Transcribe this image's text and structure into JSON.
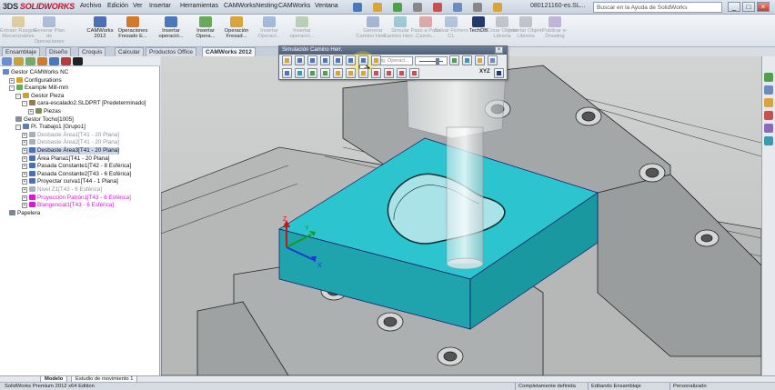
{
  "app": {
    "brand_ds": "3DS",
    "brand_name": "SOLIDWORKS",
    "menu": [
      "Archivo",
      "Edición",
      "Ver",
      "Insertar",
      "Herramientas",
      "CAMWorksNesting",
      "CAMWorks",
      "Ventana"
    ],
    "doc_title": "080121160-es.SL...",
    "search_placeholder": "Buscar en la Ayuda de SolidWorks",
    "window_buttons": [
      "_",
      "□",
      "×"
    ]
  },
  "command_bar": {
    "items": [
      {
        "label": "Extraer Rasgos Mecanizables",
        "enabled": false
      },
      {
        "label": "Generar Plan de Operaciones",
        "enabled": false
      },
      {
        "label": "CAMWorks 2012",
        "enabled": true
      },
      {
        "label": "Operaciones Fresado E...",
        "enabled": true
      },
      {
        "label": "Insertar operació...",
        "enabled": true
      },
      {
        "label": "Insertar Opera...",
        "enabled": true
      },
      {
        "label": "Operación Fresad...",
        "enabled": true
      },
      {
        "label": "Insertar Operaci...",
        "enabled": false
      },
      {
        "label": "Insertar operació...",
        "enabled": false
      },
      {
        "label": "Generar Camino Herr...",
        "enabled": false
      },
      {
        "label": "Simular Camino Herr...",
        "enabled": false
      },
      {
        "label": "Paso a Paso Camin...",
        "enabled": false
      },
      {
        "label": "Salvar Fichero CL",
        "enabled": false
      },
      {
        "label": "TechDB",
        "enabled": true
      },
      {
        "label": "Crear Objeto Libreria",
        "enabled": false
      },
      {
        "label": "Insertar Objeto Libreria",
        "enabled": false
      },
      {
        "label": "Publicar e-Drawing",
        "enabled": false
      }
    ]
  },
  "tabs": [
    {
      "label": "Ensamblaje",
      "active": false
    },
    {
      "label": "Diseño",
      "active": false
    },
    {
      "label": "Croquis",
      "active": false
    },
    {
      "label": "Calcular",
      "active": false
    },
    {
      "label": "Productos Office",
      "active": false
    },
    {
      "label": "CAMWorks 2012",
      "active": true
    }
  ],
  "tree": {
    "rows": [
      {
        "label": "Gestor CAMWorks NC",
        "indent": 0,
        "style": "",
        "icon": "#5b8bc9"
      },
      {
        "label": "Configurations",
        "indent": 1,
        "style": "",
        "icon": "#d4a429",
        "exp": "+"
      },
      {
        "label": "Example Mill-mm",
        "indent": 1,
        "style": "",
        "icon": "#6aa85a",
        "exp": "-"
      },
      {
        "label": "Gestor Pieza",
        "indent": 2,
        "style": "",
        "icon": "#c9a13c",
        "exp": "-"
      },
      {
        "label": "cara-escalado2.SLDPRT [Predeterminado]",
        "indent": 3,
        "style": "",
        "icon": "#9a7b4f",
        "exp": "-"
      },
      {
        "label": "Piezas",
        "indent": 4,
        "style": "",
        "icon": "#7e8f55",
        "exp": "+"
      },
      {
        "label": "Gestor Tocho[1005]",
        "indent": 2,
        "style": "",
        "icon": "#8a8f96"
      },
      {
        "label": "Pl. Trabajo1 [Grupo1]",
        "indent": 2,
        "style": "",
        "icon": "#5f7fb3",
        "exp": "-"
      },
      {
        "label": "Desbaste Área1[T41 - 20 Plana]",
        "indent": 3,
        "style": "grey",
        "icon": "#a9b0b8",
        "exp": "+"
      },
      {
        "label": "Desbaste Área2[T41 - 20 Plana]",
        "indent": 3,
        "style": "grey",
        "icon": "#a9b0b8",
        "exp": "+"
      },
      {
        "label": "Desbaste Área3[T41 - 20 Plana]",
        "indent": 3,
        "style": "hl",
        "icon": "#4e6fb0",
        "exp": "+"
      },
      {
        "label": "Área Plana1[T41 - 20 Plana]",
        "indent": 3,
        "style": "",
        "icon": "#4e6fb0",
        "exp": "+"
      },
      {
        "label": "Pasada Constante1[T42 - 8 Esférica]",
        "indent": 3,
        "style": "",
        "icon": "#4e6fb0",
        "exp": "+"
      },
      {
        "label": "Pasada Constante2[T43 - 6 Esférica]",
        "indent": 3,
        "style": "",
        "icon": "#4e6fb0",
        "exp": "+"
      },
      {
        "label": "Proyectar curva1[T44 - 1 Plana]",
        "indent": 3,
        "style": "",
        "icon": "#4e6fb0",
        "exp": "+"
      },
      {
        "label": "Nivel Z1[T43 - 6 Esférica]",
        "indent": 3,
        "style": "grey",
        "icon": "#a9b0b8",
        "exp": "+"
      },
      {
        "label": "Proyección Patrón1[T43 - 6 Esférica]",
        "indent": 3,
        "style": "magenta",
        "icon": "#d41bd4",
        "exp": "+"
      },
      {
        "label": "Blangencial1[T43 - 6 Esférica]",
        "indent": 3,
        "style": "magenta",
        "icon": "#d41bd4",
        "exp": "+"
      },
      {
        "label": "Papelera",
        "indent": 1,
        "style": "",
        "icon": "#7a8797"
      }
    ]
  },
  "sim_toolbar": {
    "title": "Simulación Camino Herr.",
    "select_value": "Sig. Operaci...",
    "speed_label": "XYZ"
  },
  "triad": {
    "x": "X",
    "y": "Y",
    "z": "Z"
  },
  "bottom_tabs": [
    "Modelo",
    "Estudio de movimiento 1"
  ],
  "status": {
    "edition": "SolidWorks Premium 2012 x64 Edition",
    "state1": "Completamente definida",
    "state2": "Editando Ensamblaje",
    "custom": "Personalizado"
  },
  "colors": {
    "part": "#22b5c2",
    "vise": "#a7aaaa",
    "accent_red": "#c8102e"
  }
}
